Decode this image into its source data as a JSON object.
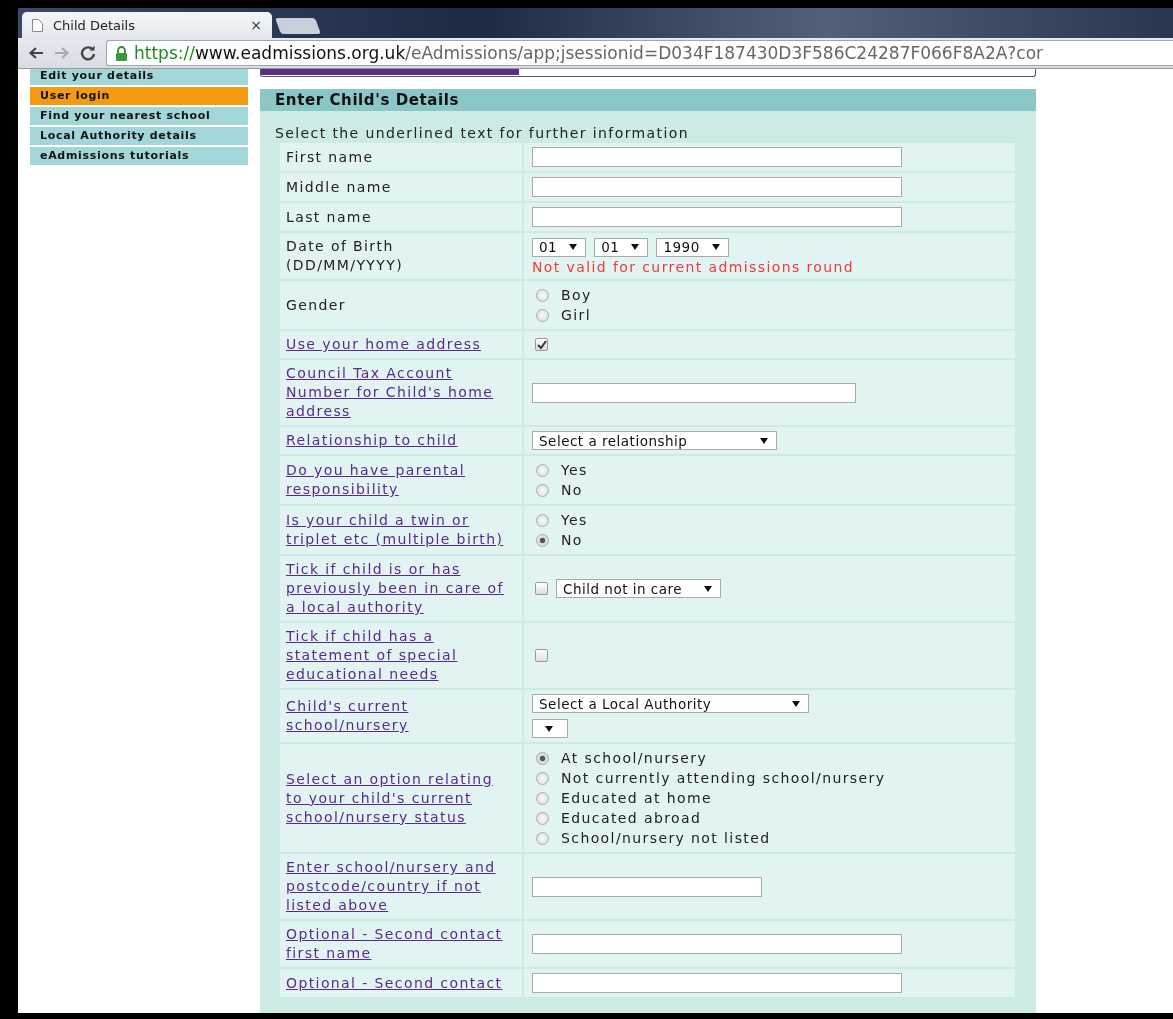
{
  "browser": {
    "tab_title": "Child Details",
    "tab_close": "×",
    "url_scheme": "https://",
    "url_host": "www.eadmissions.org.uk",
    "url_path": "/eAdmissions/app;jsessionid=D034F187430D3F586C24287F066F8A2A?cor"
  },
  "sidebar": {
    "items": [
      {
        "label": "Edit your details",
        "selected": false
      },
      {
        "label": "User login",
        "selected": true
      },
      {
        "label": "Find your nearest school",
        "selected": false
      },
      {
        "label": "Local Authority details",
        "selected": false
      },
      {
        "label": "eAdmissions tutorials",
        "selected": false
      }
    ]
  },
  "form": {
    "title": "Enter Child's Details",
    "intro": "Select the underlined text for further information",
    "rows": [
      {
        "label": "First name",
        "link": false,
        "kind": "text_long"
      },
      {
        "label": "Middle name",
        "link": false,
        "kind": "text_long"
      },
      {
        "label": "Last name",
        "link": false,
        "kind": "text_long"
      },
      {
        "label": "Date of Birth",
        "hint": "(DD/MM/YYYY)",
        "link": false,
        "kind": "date",
        "selects": [
          {
            "value": "01"
          },
          {
            "value": "01"
          },
          {
            "value": "1990"
          }
        ],
        "error": "Not valid for current admissions round"
      },
      {
        "label": "Gender",
        "link": false,
        "kind": "radio",
        "options": [
          {
            "label": "Boy",
            "selected": false
          },
          {
            "label": "Girl",
            "selected": false
          }
        ]
      },
      {
        "label": "Use your home address",
        "link": true,
        "kind": "checkbox",
        "checked": true
      },
      {
        "label": "Council Tax Account Number for Child's home address",
        "link": true,
        "kind": "text_medium"
      },
      {
        "label": "Relationship to child",
        "link": true,
        "kind": "select",
        "selects": [
          {
            "value": "Select a relationship"
          }
        ]
      },
      {
        "label": "Do you have parental responsibility",
        "link": true,
        "kind": "radio",
        "options": [
          {
            "label": "Yes",
            "selected": false
          },
          {
            "label": "No",
            "selected": false
          }
        ]
      },
      {
        "label": "Is your child a twin or triplet etc (multiple birth)",
        "link": true,
        "kind": "radio",
        "options": [
          {
            "label": "Yes",
            "selected": false
          },
          {
            "label": "No",
            "selected": true
          }
        ]
      },
      {
        "label": "Tick if child is or has previously been in care of a local authority",
        "link": true,
        "kind": "checkbox_select",
        "checked": false,
        "selects": [
          {
            "value": "Child not in care"
          }
        ]
      },
      {
        "label": "Tick if child has a statement of special educational needs",
        "link": true,
        "kind": "checkbox",
        "checked": false
      },
      {
        "label": "Child's current school/nursery",
        "link": true,
        "kind": "select_stack",
        "selects": [
          {
            "value": "Select a Local Authority"
          }
        ],
        "empty_select": true
      },
      {
        "label": "Select an option relating to your child's current school/nursery status",
        "link": true,
        "kind": "radio",
        "options": [
          {
            "label": "At school/nursery",
            "selected": true
          },
          {
            "label": "Not currently attending school/nursery",
            "selected": false
          },
          {
            "label": "Educated at home",
            "selected": false
          },
          {
            "label": "Educated abroad",
            "selected": false
          },
          {
            "label": "School/nursery not listed",
            "selected": false
          }
        ]
      },
      {
        "label": "Enter school/nursery and postcode/country if not listed above",
        "link": true,
        "kind": "text_short"
      },
      {
        "label": "Optional - Second contact first name",
        "link": true,
        "kind": "text_long"
      },
      {
        "label": "Optional - Second contact",
        "link": true,
        "kind": "text_long"
      }
    ]
  }
}
